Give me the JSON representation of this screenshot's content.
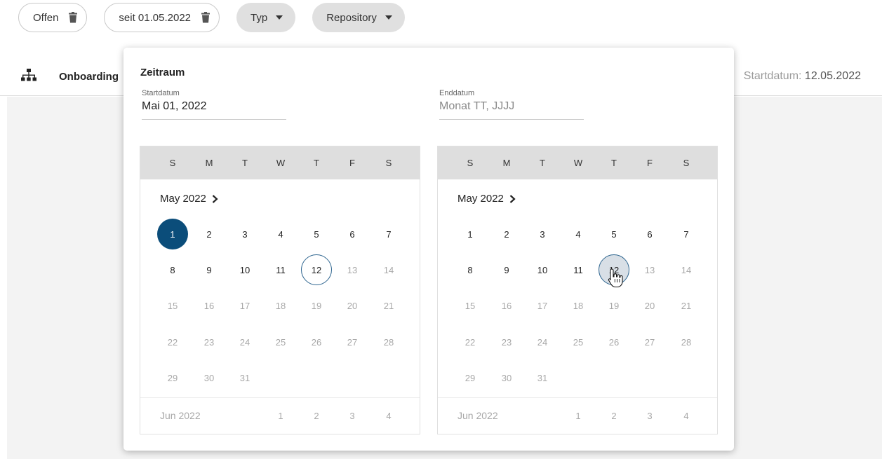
{
  "filters": {
    "chip_offen": "Offen",
    "chip_date": "seit 01.05.2022",
    "chip_typ": "Typ",
    "chip_repository": "Repository"
  },
  "list_row": {
    "title": "Onboarding",
    "date_label": "Startdatum:",
    "date_value": "12.05.2022"
  },
  "popup": {
    "title": "Zeitraum",
    "start_label": "Startdatum",
    "start_value": "Mai 01, 2022",
    "end_label": "Enddatum",
    "end_placeholder": "Monat TT, JJJJ"
  },
  "weekdays": [
    "S",
    "M",
    "T",
    "W",
    "T",
    "F",
    "S"
  ],
  "calendars": [
    {
      "month_label": "May 2022",
      "next_month_label": "Jun 2022",
      "next_month_days": [
        "1",
        "2",
        "3",
        "4"
      ],
      "selected_day": "1",
      "today_day": "12",
      "hover_day": ""
    },
    {
      "month_label": "May 2022",
      "next_month_label": "Jun 2022",
      "next_month_days": [
        "1",
        "2",
        "3",
        "4"
      ],
      "selected_day": "",
      "today_day": "",
      "hover_day": "12"
    }
  ],
  "month_days": [
    "1",
    "2",
    "3",
    "4",
    "5",
    "6",
    "7",
    "8",
    "9",
    "10",
    "11",
    "12",
    "13",
    "14",
    "15",
    "16",
    "17",
    "18",
    "19",
    "20",
    "21",
    "22",
    "23",
    "24",
    "25",
    "26",
    "27",
    "28",
    "29",
    "30",
    "31"
  ],
  "last_enabled_day": "12",
  "colors": {
    "selected": "#0b4d7a",
    "accent_ring": "#2f6690",
    "disabled_text": "#a8a8a8",
    "header_bg": "#dedede"
  }
}
